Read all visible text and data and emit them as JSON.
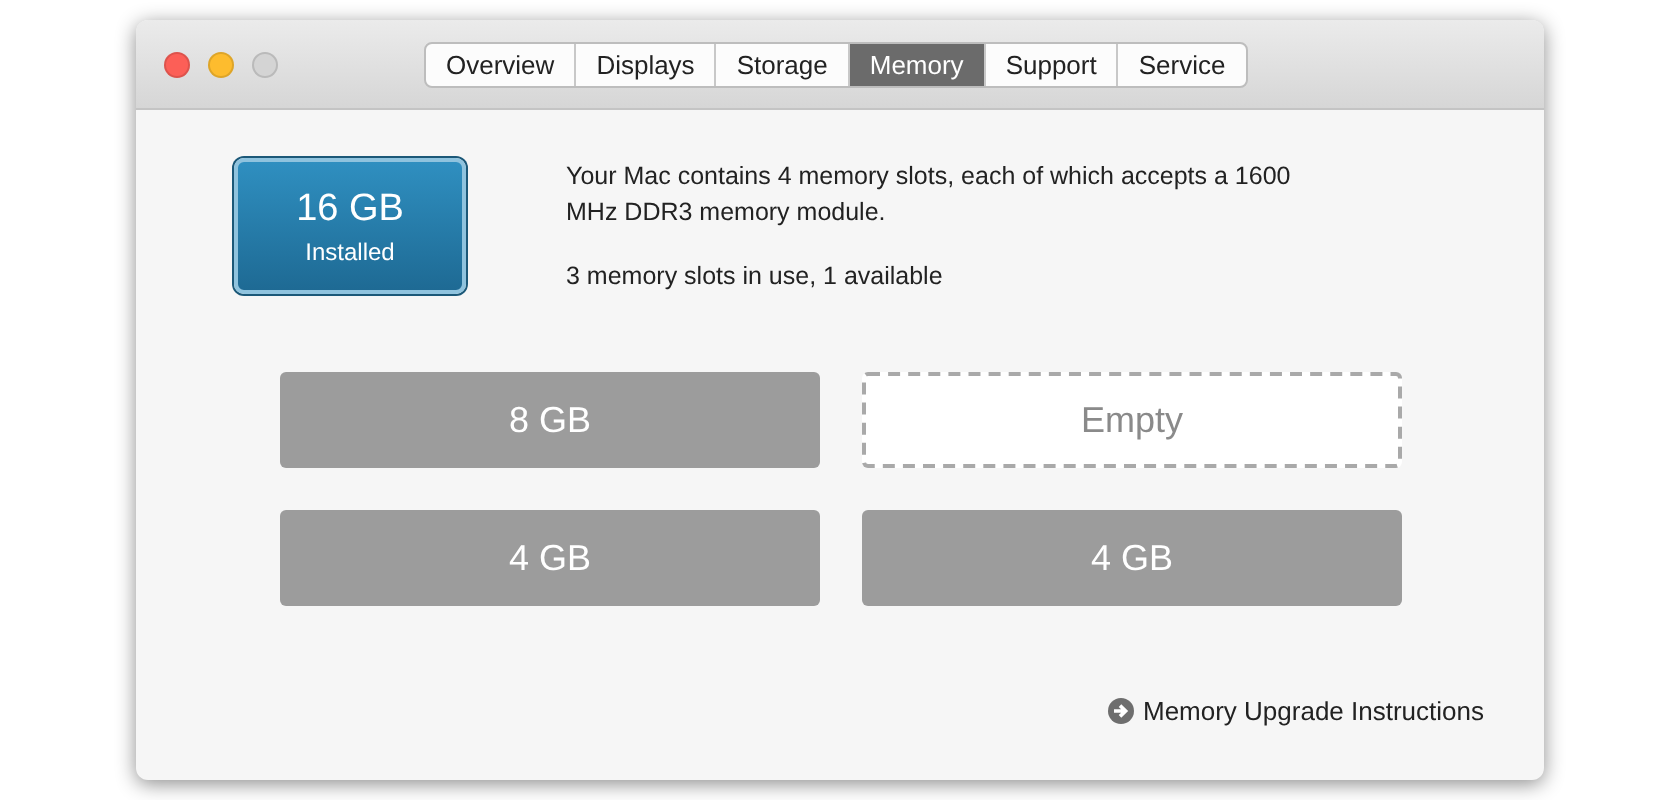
{
  "window": {
    "buttons": [
      {
        "kind": "close"
      },
      {
        "kind": "minimize"
      },
      {
        "kind": "zoom"
      }
    ]
  },
  "tabs": [
    {
      "label": "Overview",
      "selected": false
    },
    {
      "label": "Displays",
      "selected": false
    },
    {
      "label": "Storage",
      "selected": false
    },
    {
      "label": "Memory",
      "selected": true
    },
    {
      "label": "Support",
      "selected": false
    },
    {
      "label": "Service",
      "selected": false
    }
  ],
  "summary": {
    "amount": "16 GB",
    "caption": "Installed"
  },
  "description": [
    "Your Mac contains 4 memory slots, each of which accepts a 1600 MHz DDR3 memory module.",
    "3 memory slots in use, 1 available"
  ],
  "slots": [
    {
      "label": "8 GB",
      "kind": "filled"
    },
    {
      "label": "Empty",
      "kind": "empty"
    },
    {
      "label": "4 GB",
      "kind": "filled"
    },
    {
      "label": "4 GB",
      "kind": "filled"
    }
  ],
  "link": {
    "label": "Memory Upgrade Instructions"
  }
}
